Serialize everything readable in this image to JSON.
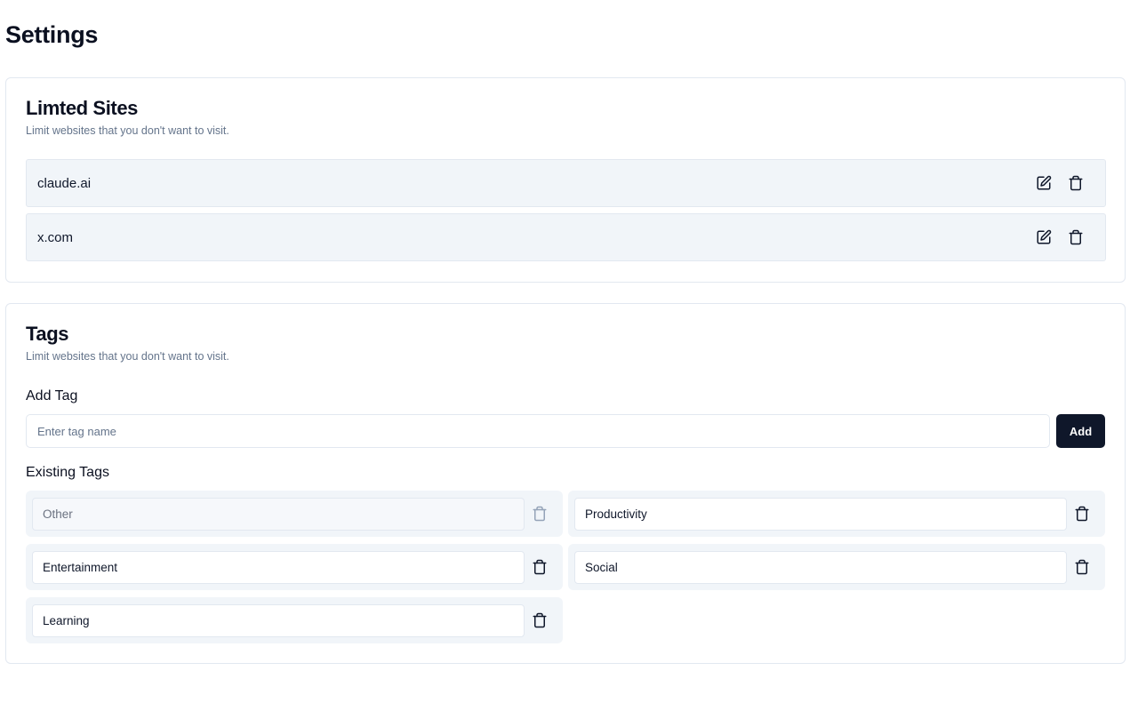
{
  "page": {
    "title": "Settings"
  },
  "limited_sites": {
    "title": "Limted Sites",
    "description": "Limit websites that you don't want to visit.",
    "sites": [
      {
        "name": "claude.ai"
      },
      {
        "name": "x.com"
      }
    ],
    "edit_icon": "edit-icon",
    "delete_icon": "trash-icon"
  },
  "tags": {
    "title": "Tags",
    "description": "Limit websites that you don't want to visit.",
    "add_label": "Add Tag",
    "input_placeholder": "Enter tag name",
    "input_value": "",
    "add_button_label": "Add",
    "existing_label": "Existing Tags",
    "items": [
      {
        "name": "Other",
        "disabled": true
      },
      {
        "name": "Productivity",
        "disabled": false
      },
      {
        "name": "Entertainment",
        "disabled": false
      },
      {
        "name": "Social",
        "disabled": false
      },
      {
        "name": "Learning",
        "disabled": false
      }
    ]
  },
  "colors": {
    "primary_button": "#0f172a",
    "row_background": "#f1f5f9",
    "border": "#e2e8f0",
    "muted_text": "#64748b"
  }
}
